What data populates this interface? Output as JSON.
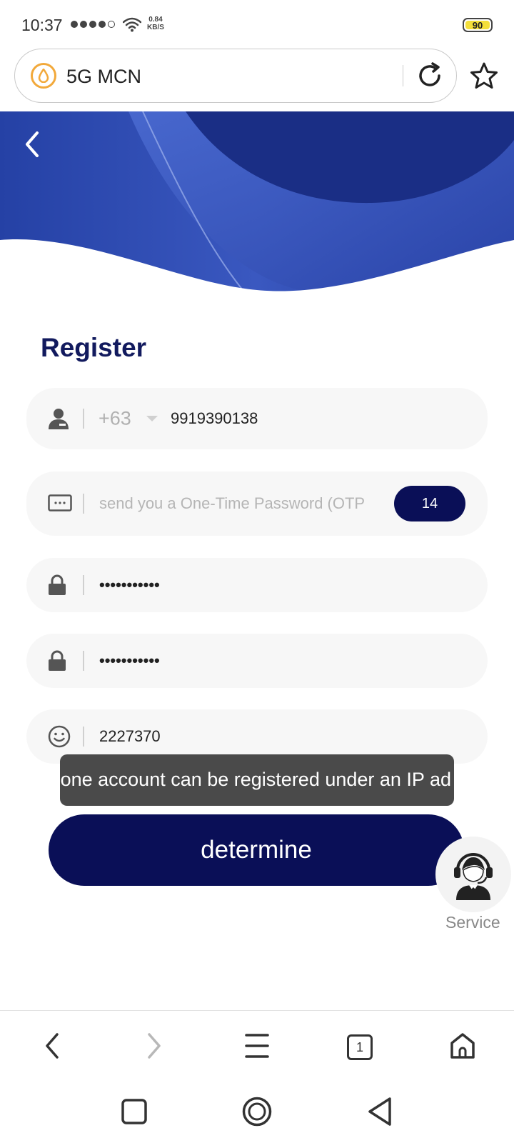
{
  "status_bar": {
    "time": "10:37",
    "net_speed_value": "0.84",
    "net_speed_unit": "KB/S",
    "battery": "90"
  },
  "browser": {
    "site_title": "5G MCN",
    "tab_count": "1"
  },
  "page": {
    "title": "Register",
    "phone": {
      "country_code": "+63",
      "value": "9919390138"
    },
    "otp": {
      "placeholder": "send you a One-Time Password (OTP",
      "countdown": "14"
    },
    "password": {
      "value": "•••••••••••"
    },
    "confirm_password": {
      "value": "•••••••••••"
    },
    "invite_code": {
      "value": "2227370"
    },
    "toast": "one account can be registered under an IP ad",
    "submit_label": "determine",
    "service_label": "Service"
  },
  "colors": {
    "primary": "#0a0f57",
    "title": "#121a5e",
    "banner": "#2f4bb0",
    "field_bg": "#f7f7f7",
    "toast_bg": "#4a4a4a"
  }
}
